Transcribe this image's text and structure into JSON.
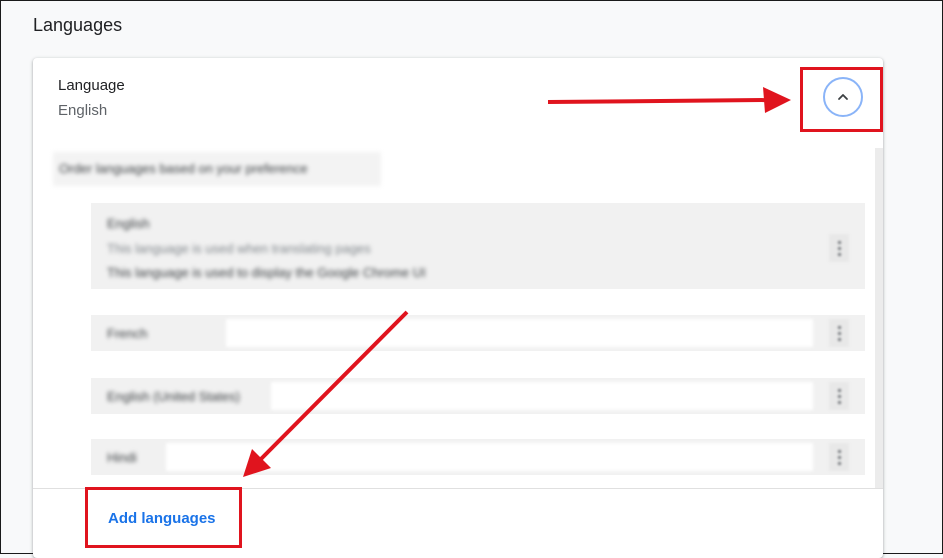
{
  "section": {
    "title": "Languages"
  },
  "language_card": {
    "label": "Language",
    "value": "English",
    "expand_icon": "chevron-up-icon"
  },
  "order_label": "Order languages based on your preference",
  "language_list": [
    {
      "name": "English",
      "notes": [
        "This language is used when translating pages",
        "This language is used to display the Google Chrome UI"
      ]
    },
    {
      "name": "French"
    },
    {
      "name": "English (United States)"
    },
    {
      "name": "Hindi"
    }
  ],
  "add_languages_label": "Add languages",
  "colors": {
    "accent": "#1a73e8",
    "annotation": "#e0141e",
    "focus_ring": "#8ab4f8"
  }
}
